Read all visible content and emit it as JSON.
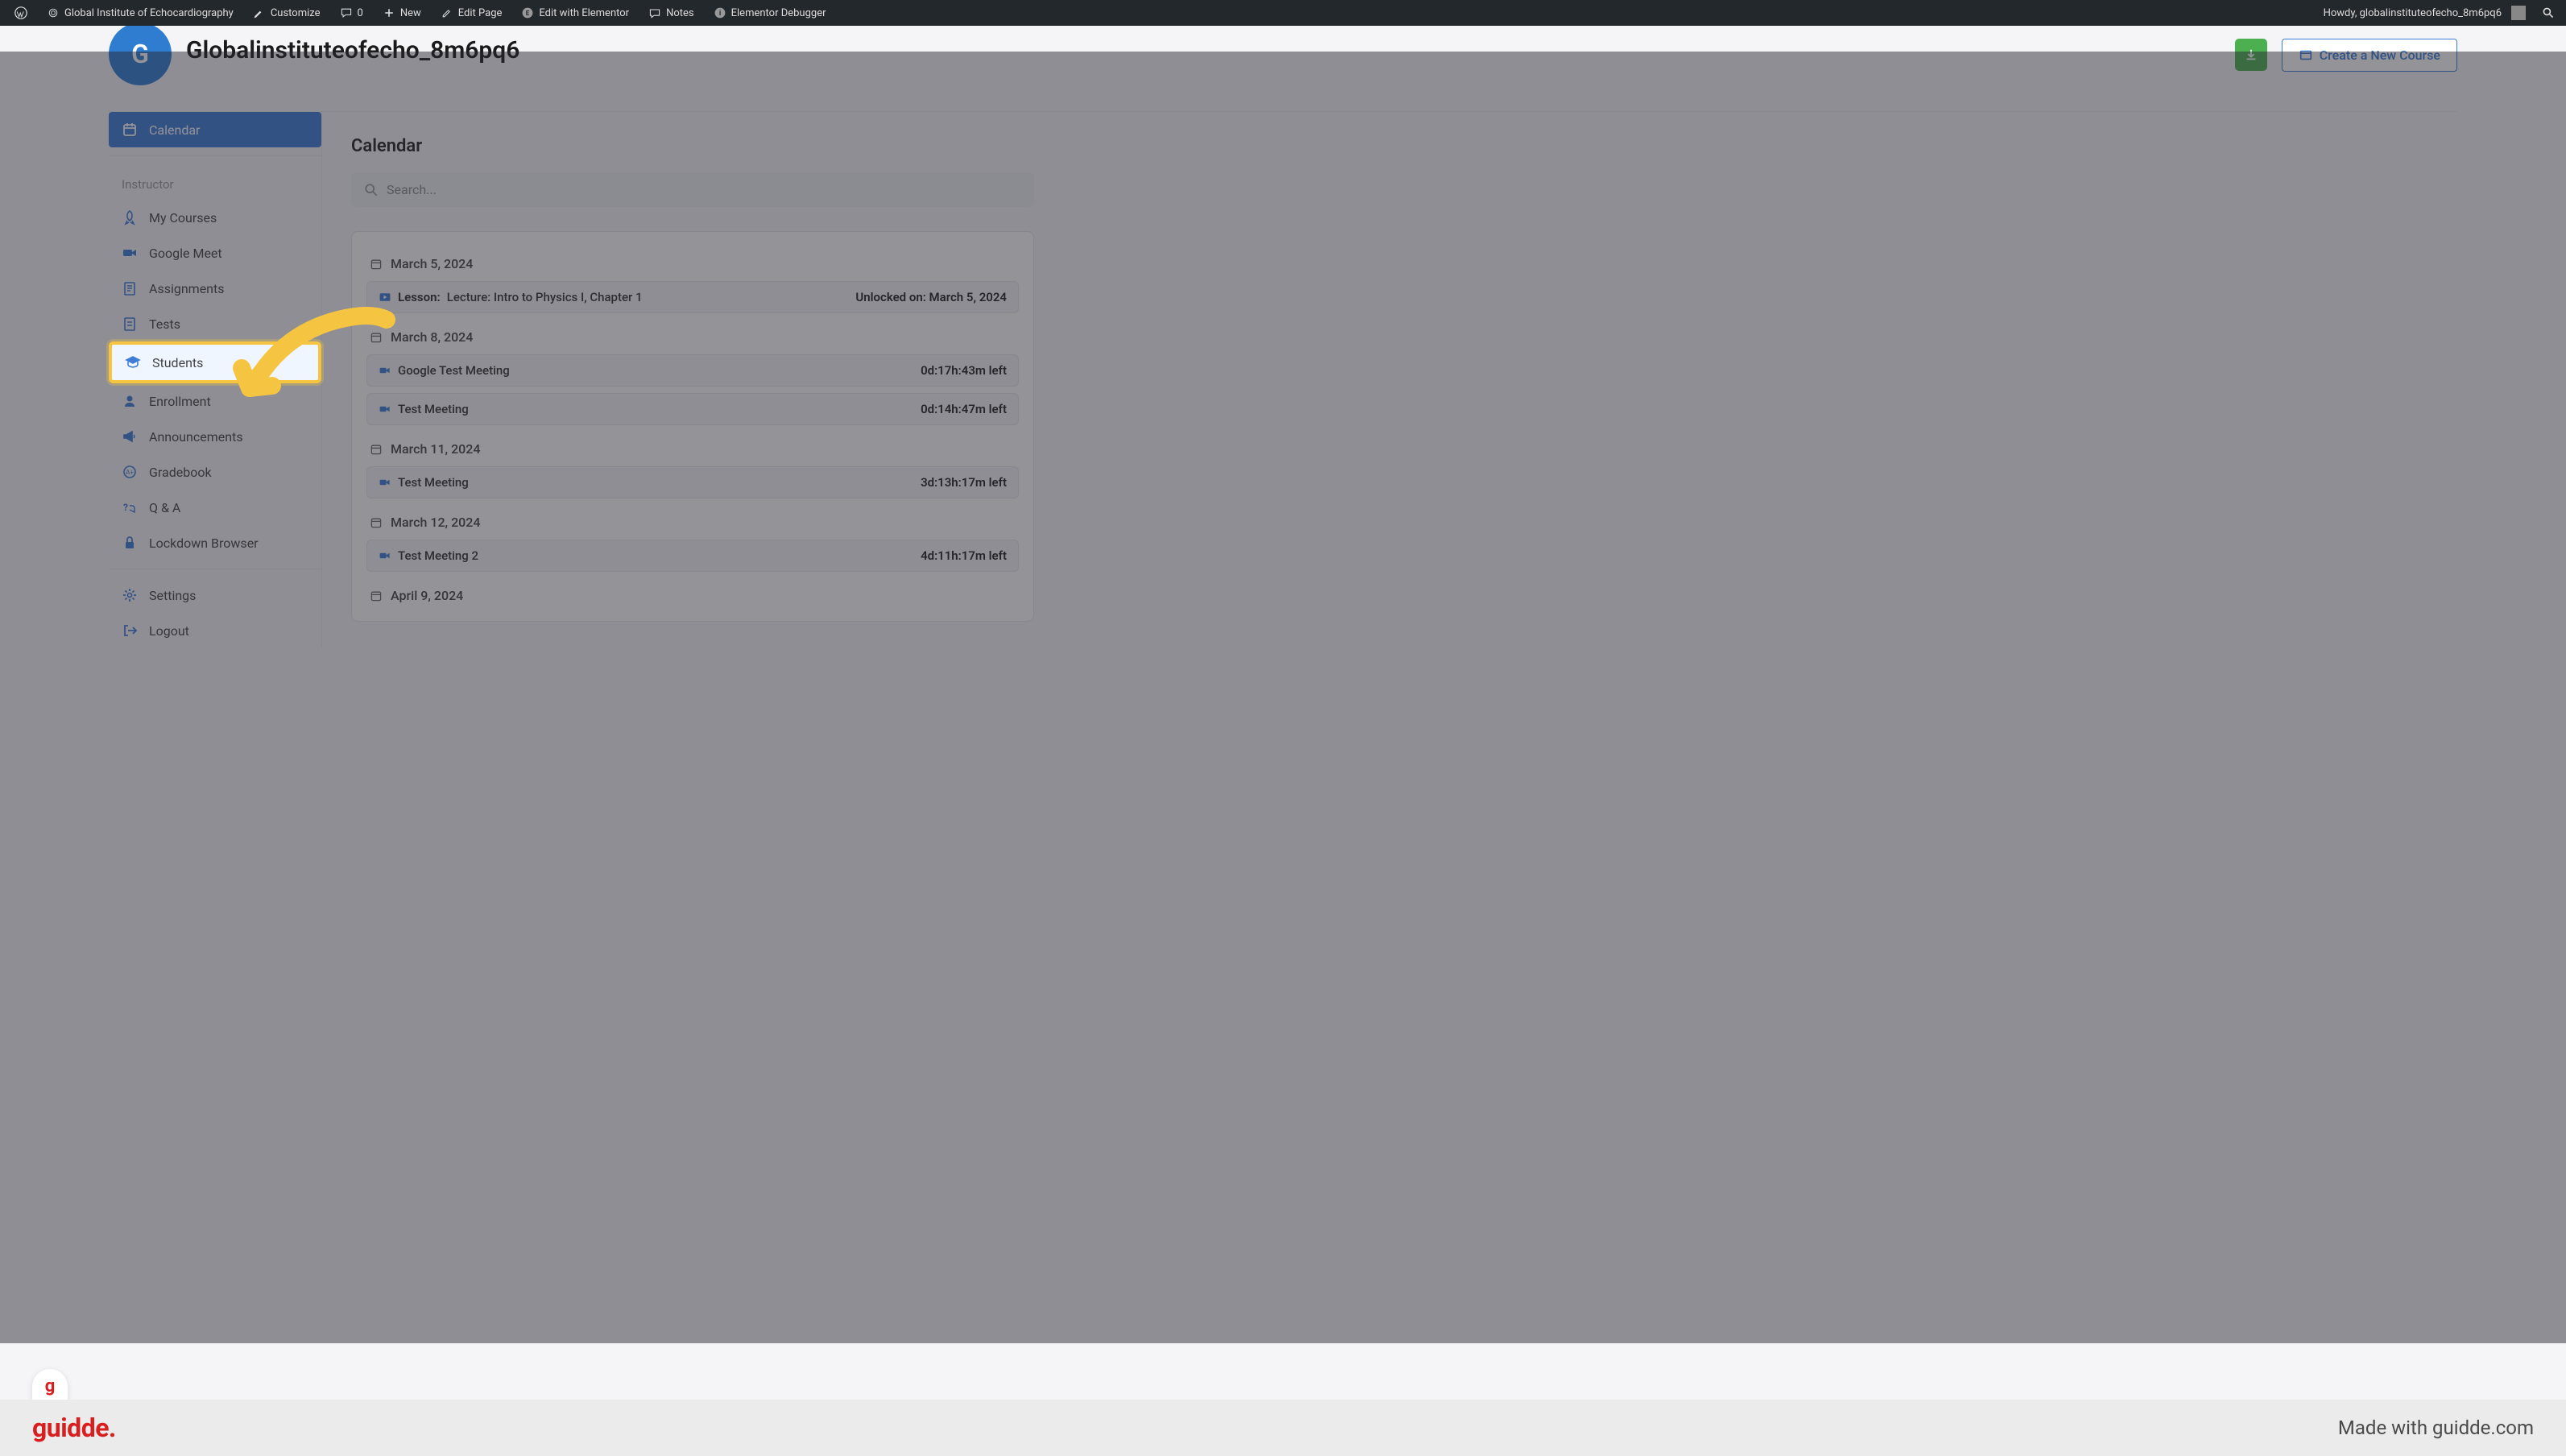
{
  "admin_bar": {
    "site_name": "Global Institute of Echocardiography",
    "customize": "Customize",
    "comments_count": "0",
    "new": "New",
    "edit_page": "Edit Page",
    "edit_elementor": "Edit with Elementor",
    "notes": "Notes",
    "elementor_debugger": "Elementor Debugger",
    "howdy": "Howdy, globalinstituteofecho_8m6pq6"
  },
  "header": {
    "avatar_initial": "G",
    "page_title": "Globalinstituteofecho_8m6pq6",
    "create_course": "Create a New Course"
  },
  "sidebar": {
    "calendar": "Calendar",
    "section_instructor": "Instructor",
    "items": {
      "my_courses": "My Courses",
      "google_meet": "Google Meet",
      "assignments": "Assignments",
      "tests": "Tests",
      "students": "Students",
      "enrollment": "Enrollment",
      "announcements": "Announcements",
      "gradebook": "Gradebook",
      "qa": "Q & A",
      "lockdown": "Lockdown Browser",
      "settings": "Settings",
      "logout": "Logout"
    }
  },
  "main": {
    "title": "Calendar",
    "search_placeholder": "Search...",
    "dates": {
      "d1": "March 5, 2024",
      "d2": "March 8, 2024",
      "d3": "March 11, 2024",
      "d4": "March 12, 2024",
      "d5": "April 9, 2024"
    },
    "events": {
      "e1_prefix": "Lesson:",
      "e1_title": "Lecture: Intro to Physics I, Chapter 1",
      "e1_meta": "Unlocked on: March 5, 2024",
      "e2_title": "Google Test Meeting",
      "e2_meta": "0d:17h:43m left",
      "e3_title": "Test Meeting",
      "e3_meta": "0d:14h:47m left",
      "e4_title": "Test Meeting",
      "e4_meta": "3d:13h:17m left",
      "e5_title": "Test Meeting 2",
      "e5_meta": "4d:11h:17m left"
    }
  },
  "footer": {
    "logo": "guidde.",
    "tagline": "Made with guidde.com"
  }
}
